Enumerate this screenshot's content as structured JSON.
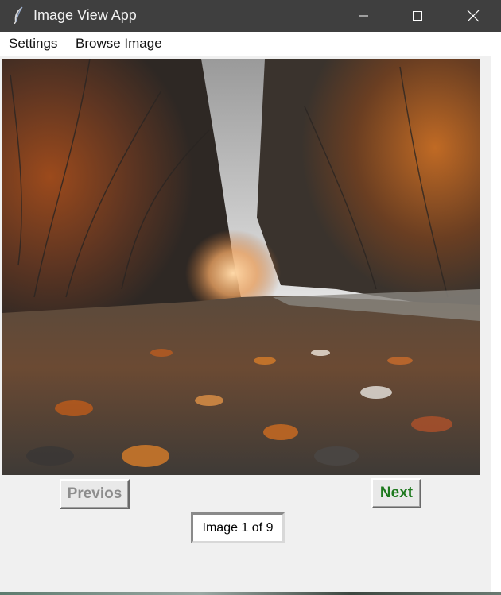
{
  "window": {
    "title": "Image View App",
    "icon": "feather-icon",
    "controls": [
      "minimize-icon",
      "maximize-icon",
      "close-icon"
    ]
  },
  "menu": {
    "items": [
      {
        "label": "Settings"
      },
      {
        "label": "Browse Image"
      }
    ]
  },
  "viewer": {
    "image_subject": "autumn forest path"
  },
  "navigation": {
    "previous_label": "Previos",
    "next_label": "Next",
    "status": "Image 1 of 9"
  },
  "colors": {
    "titlebar": "#3f3f3f",
    "next_text": "#1f7a1f",
    "previous_text_disabled": "#8d8d8d",
    "window_bg": "#f0f0f0"
  }
}
